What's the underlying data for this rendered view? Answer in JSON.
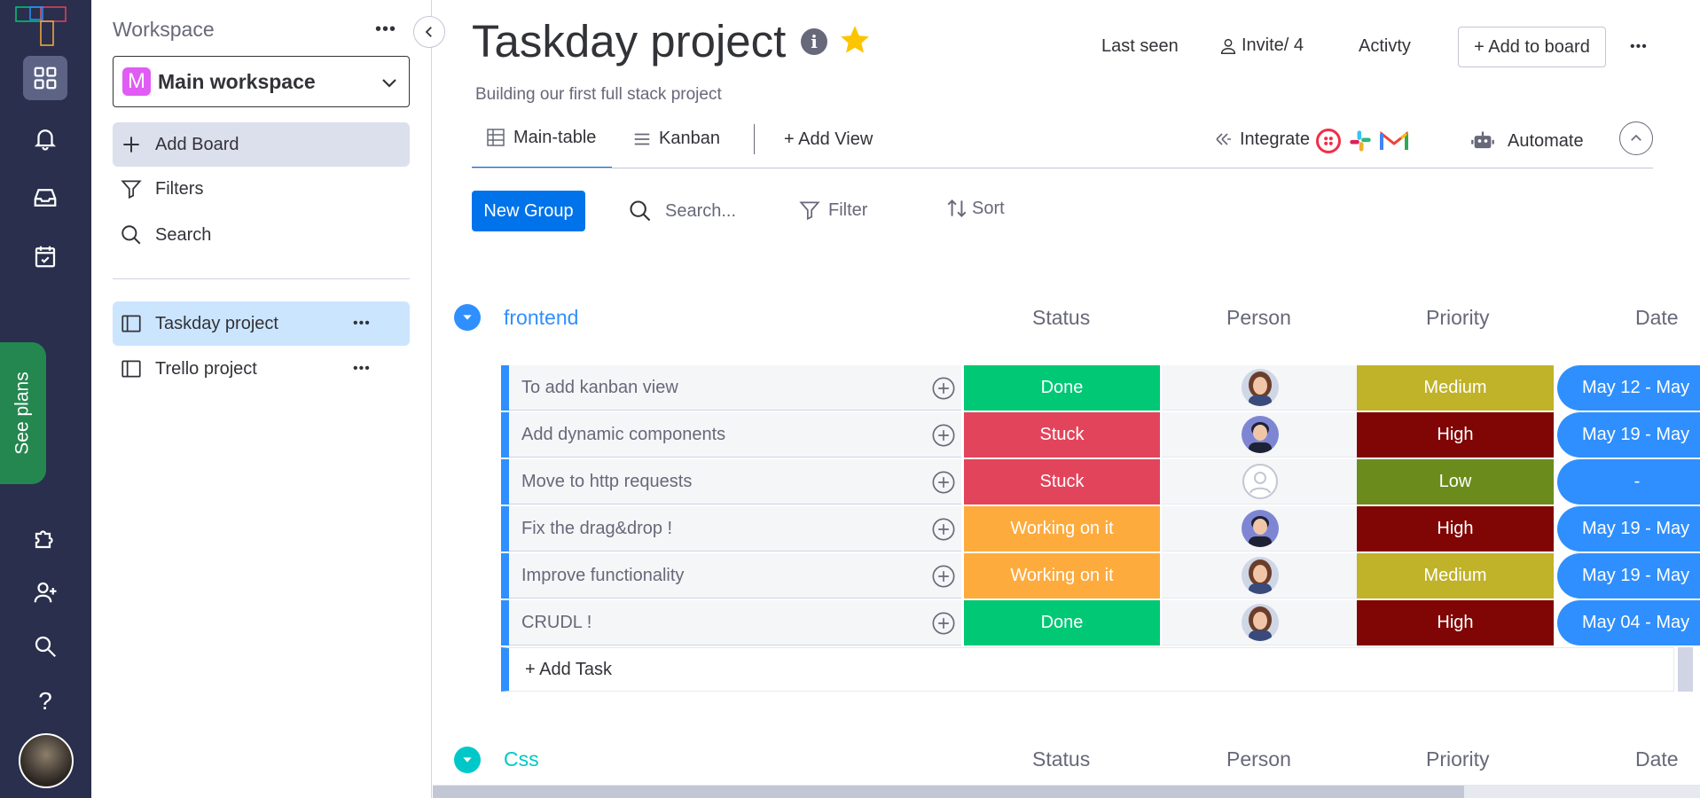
{
  "rail": {
    "icons": [
      "apps-icon",
      "bell-icon",
      "inbox-icon",
      "calendar-check-icon",
      "puzzle-icon",
      "add-user-icon",
      "search-icon",
      "help-icon"
    ],
    "see_plans": "See plans",
    "help_label": "?"
  },
  "sidebar": {
    "title": "Workspace",
    "more": "•••",
    "workspace_badge": "M",
    "workspace_name": "Main workspace",
    "add_board": "Add Board",
    "filters": "Filters",
    "search": "Search",
    "boards": [
      {
        "name": "Taskday project",
        "selected": true
      },
      {
        "name": "Trello project",
        "selected": false
      }
    ]
  },
  "header": {
    "title": "Taskday project",
    "description": "Building our first full stack project",
    "last_seen": "Last seen",
    "invite": "Invite/ 4",
    "activity": "Activty",
    "add_to_board": "+ Add to board",
    "more": "•••"
  },
  "views": {
    "main_table": "Main-table",
    "kanban": "Kanban",
    "add_view": "+ Add View",
    "integrate": "Integrate",
    "automate": "Automate"
  },
  "toolbar": {
    "new_group": "New Group",
    "search_placeholder": "Search...",
    "filter": "Filter",
    "sort": "Sort"
  },
  "columns": {
    "status": "Status",
    "person": "Person",
    "priority": "Priority",
    "date": "Date"
  },
  "groups": [
    {
      "name": "frontend",
      "color": "#2f8ffe",
      "tasks": [
        {
          "name": "To add kanban view",
          "status": "Done",
          "status_color": "#00c875",
          "person": "woman",
          "priority": "Medium",
          "priority_color": "#c0b229",
          "date": "May 12 - May"
        },
        {
          "name": "Add dynamic components",
          "status": "Stuck",
          "status_color": "#e2445c",
          "person": "man",
          "priority": "High",
          "priority_color": "#800505",
          "date": "May 19 - May"
        },
        {
          "name": "Move to http requests",
          "status": "Stuck",
          "status_color": "#e2445c",
          "person": "empty",
          "priority": "Low",
          "priority_color": "#6b8c1c",
          "date": "-"
        },
        {
          "name": "Fix the drag&drop !",
          "status": "Working on it",
          "status_color": "#fdab3d",
          "person": "man",
          "priority": "High",
          "priority_color": "#800505",
          "date": "May 19 - May"
        },
        {
          "name": "Improve functionality",
          "status": "Working on it",
          "status_color": "#fdab3d",
          "person": "woman",
          "priority": "Medium",
          "priority_color": "#c0b229",
          "date": "May 19 - May"
        },
        {
          "name": "CRUDL !",
          "status": "Done",
          "status_color": "#00c875",
          "person": "woman",
          "priority": "High",
          "priority_color": "#800505",
          "date": "May 04 - May"
        }
      ],
      "add_task": "+ Add Task"
    },
    {
      "name": "Css",
      "color": "#00c8c8"
    }
  ]
}
